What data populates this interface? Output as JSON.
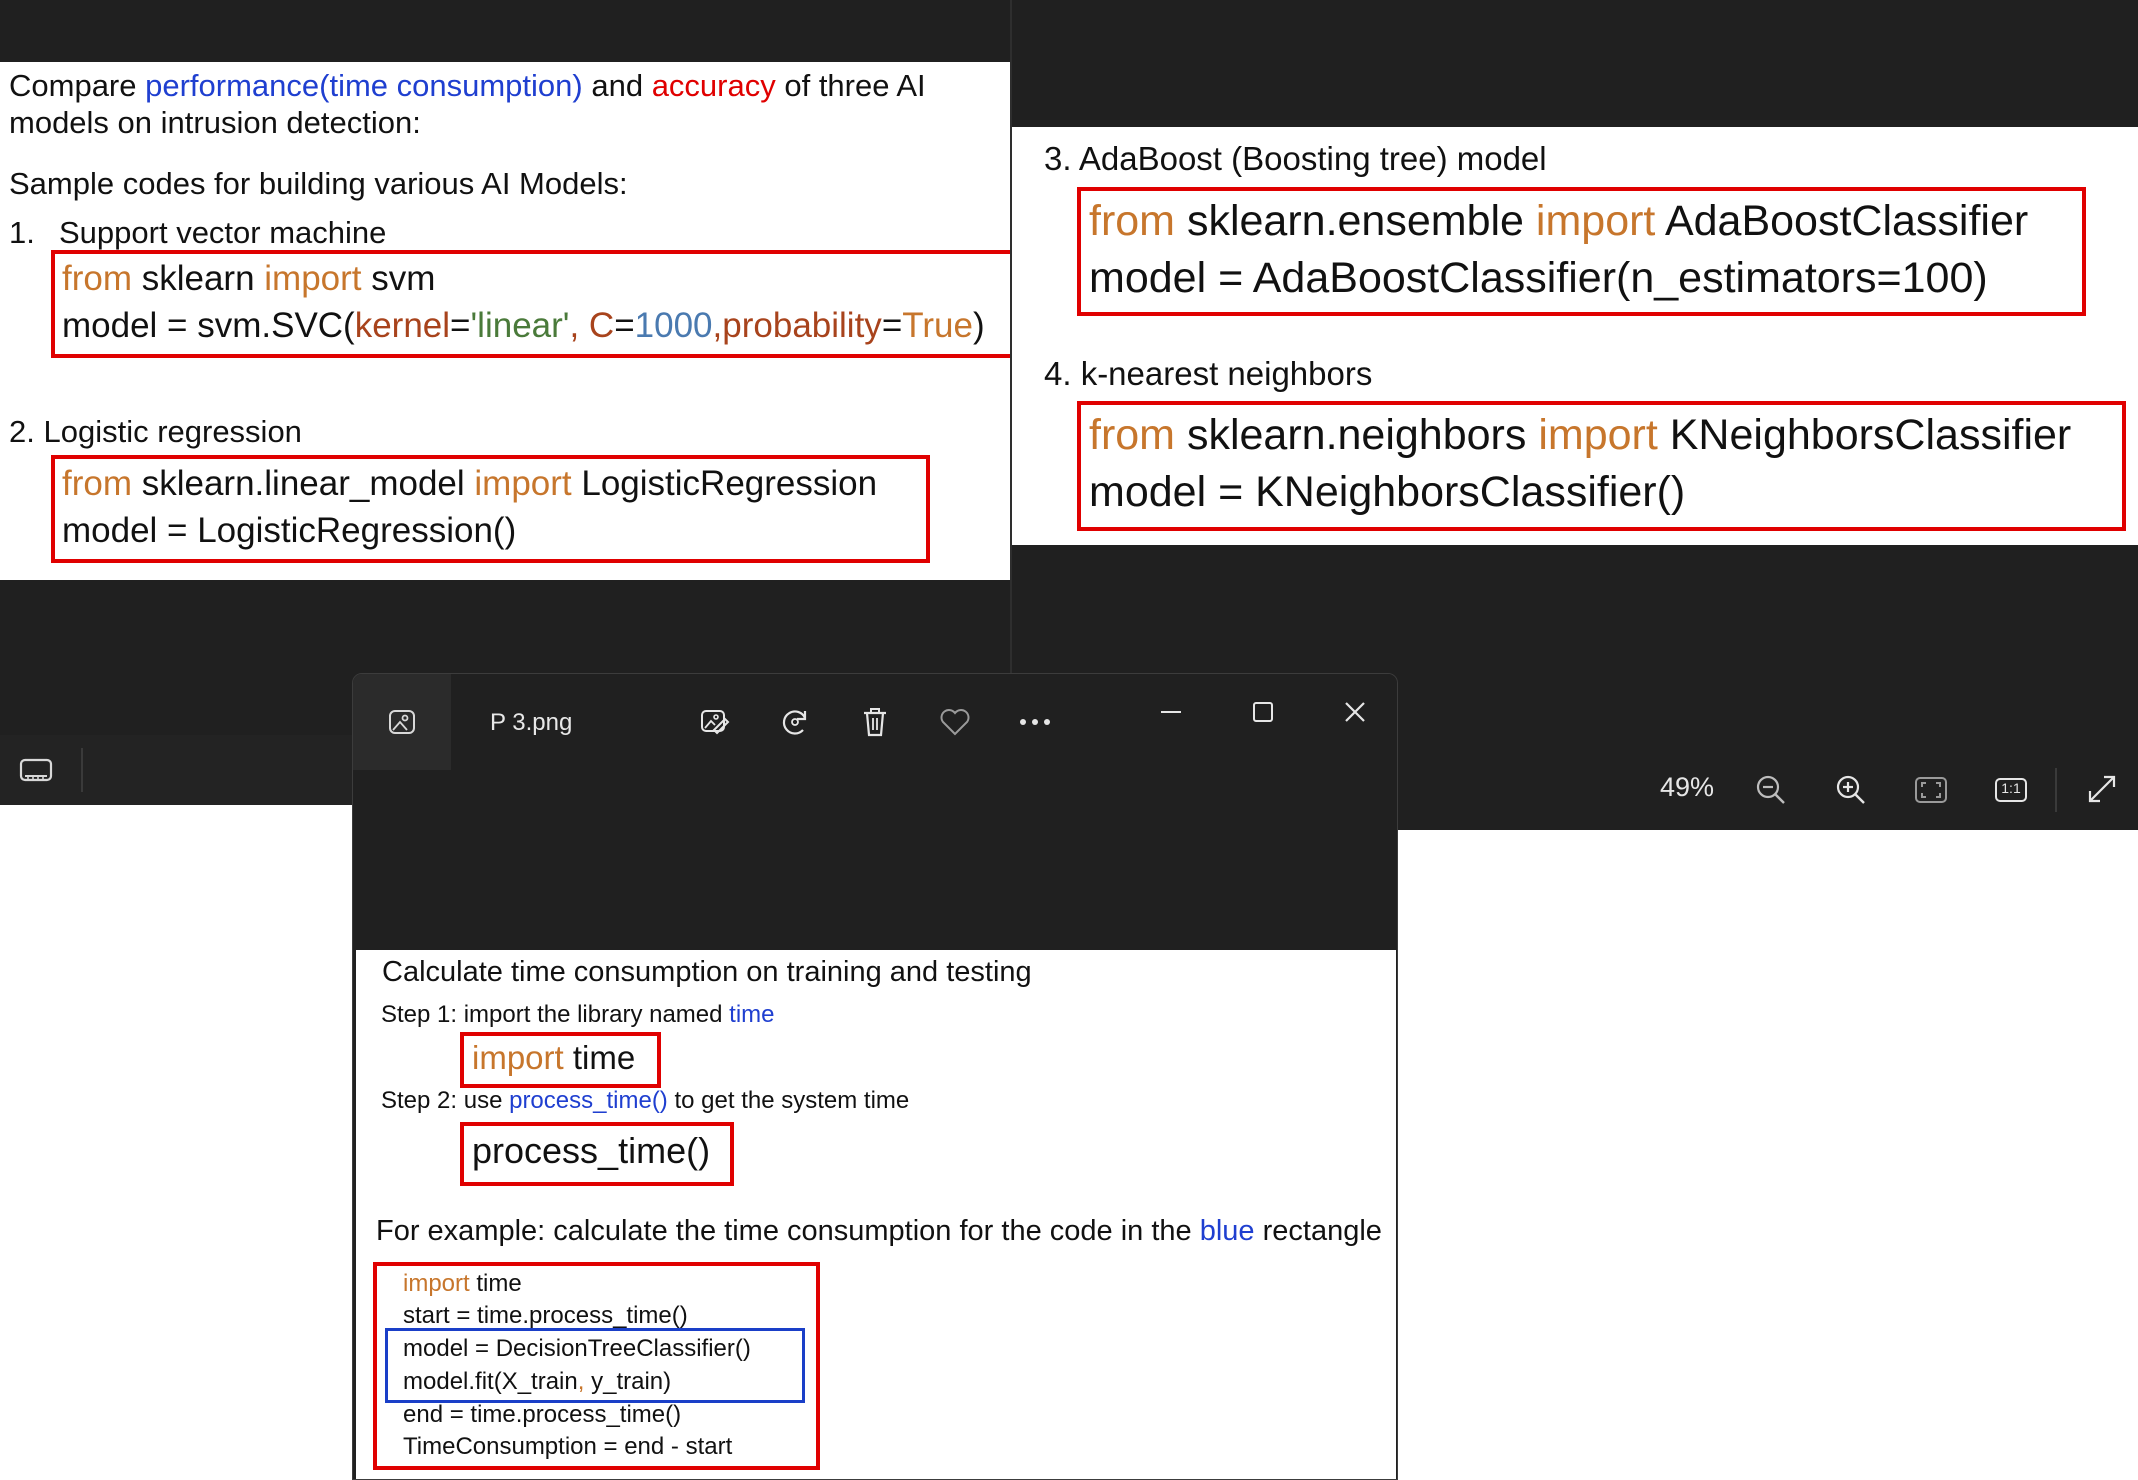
{
  "slide_left": {
    "intro_1": "Compare ",
    "intro_perf": "performance(time consumption)",
    "intro_and": " and ",
    "intro_acc": "accuracy",
    "intro_rest": " of three AI",
    "intro_2": "models on intrusion detection:",
    "sample": "Sample codes for building various AI Models:",
    "item1_num": "1.",
    "item1_title": "Support vector machine",
    "svm_from": "from",
    "svm_mod": " sklearn ",
    "svm_import": "import",
    "svm_name": " svm",
    "svm_model_a": "model = svm.SVC(",
    "svm_kernel": "kernel",
    "svm_eq1": "=",
    "svm_linear": "'linear'",
    "svm_comma1": ", ",
    "svm_c": "C",
    "svm_eq2": "=",
    "svm_1000": "1000",
    "svm_comma2": ",",
    "svm_prob": "probability",
    "svm_eq3": "=",
    "svm_true": "True",
    "svm_close": ")",
    "item2_title": "2. Logistic regression",
    "lr_from": "from",
    "lr_mod": " sklearn.linear_model ",
    "lr_import": "import",
    "lr_name": " LogisticRegression",
    "lr_model": "model = LogisticRegression()"
  },
  "slide_right": {
    "item3_title": "3. AdaBoost (Boosting tree) model",
    "ada_from": "from",
    "ada_mod": " sklearn.ensemble ",
    "ada_import": "import",
    "ada_name": " AdaBoostClassifier",
    "ada_model": "model = AdaBoostClassifier(n_estimators=100)",
    "item4_title": "4. k-nearest neighbors",
    "knn_from": "from",
    "knn_mod": " sklearn.neighbors ",
    "knn_import": "import",
    "knn_name": " KNeighborsClassifier",
    "knn_model": "model = KNeighborsClassifier()"
  },
  "viewer_left": {
    "filmstrip_icon": "filmstrip-icon"
  },
  "viewer_right": {
    "zoom_level": "49%",
    "zoom_out_icon": "zoom-out-icon",
    "zoom_in_icon": "zoom-in-icon",
    "fit_icon": "fit-screen-icon",
    "actual_size_label": "1:1",
    "fullscreen_icon": "fullscreen-icon"
  },
  "photos_window": {
    "title": "P 3.png",
    "app_icon": "photos-app-icon",
    "toolbar_icons": [
      "edit-image-icon",
      "rotate-icon",
      "delete-icon",
      "favorite-icon",
      "more-icon"
    ],
    "minimize_icon": "minimize-icon",
    "maximize_icon": "maximize-icon",
    "close_icon": "close-icon"
  },
  "slide_bottom": {
    "heading": "Calculate time consumption on training and testing",
    "step1_a": "Step 1: import the library named ",
    "step1_b": "time",
    "imp_kw": "import",
    "imp_name": " time",
    "step2_a": "Step 2: use ",
    "step2_b": "process_time()",
    "step2_c": " to get the system time",
    "pt_code": "process_time()",
    "example_a": "For example: calculate the time consumption for the code in the ",
    "example_b": "blue",
    "example_c": " rectangle",
    "code_import_kw": "import",
    "code_import_rest": " time",
    "code_start": "start = time.process_time()",
    "code_model": "model = DecisionTreeClassifier()",
    "code_fit_a": "model.fit(X_train",
    "code_fit_comma": ",",
    "code_fit_b": " y_train)",
    "code_end": "end = time.process_time()",
    "code_tc": "TimeConsumption = end - start"
  },
  "colors": {
    "highlight_red": "#e00000",
    "highlight_blue": "#1a3fc8",
    "keyword_orange": "#c7762c"
  }
}
